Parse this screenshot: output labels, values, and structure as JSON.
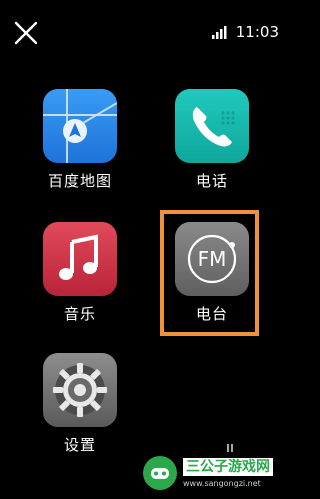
{
  "status": {
    "time": "11:03"
  },
  "apps": [
    {
      "label": "百度地图",
      "icon": "map-icon",
      "color": "#2a88ea"
    },
    {
      "label": "电话",
      "icon": "phone-icon",
      "color": "#16b9ad"
    },
    {
      "label": "音乐",
      "icon": "music-note-icon",
      "color": "#cf3547"
    },
    {
      "label": "电台",
      "icon": "fm-radio-icon",
      "color": "#757575",
      "icon_text": "FM"
    },
    {
      "label": "设置",
      "icon": "gear-icon",
      "color": "#737373"
    }
  ],
  "highlight": {
    "color": "#f0913c",
    "target": "电台"
  },
  "watermark": {
    "title": "三公子游戏网",
    "url": "www.sangongzi.net"
  }
}
